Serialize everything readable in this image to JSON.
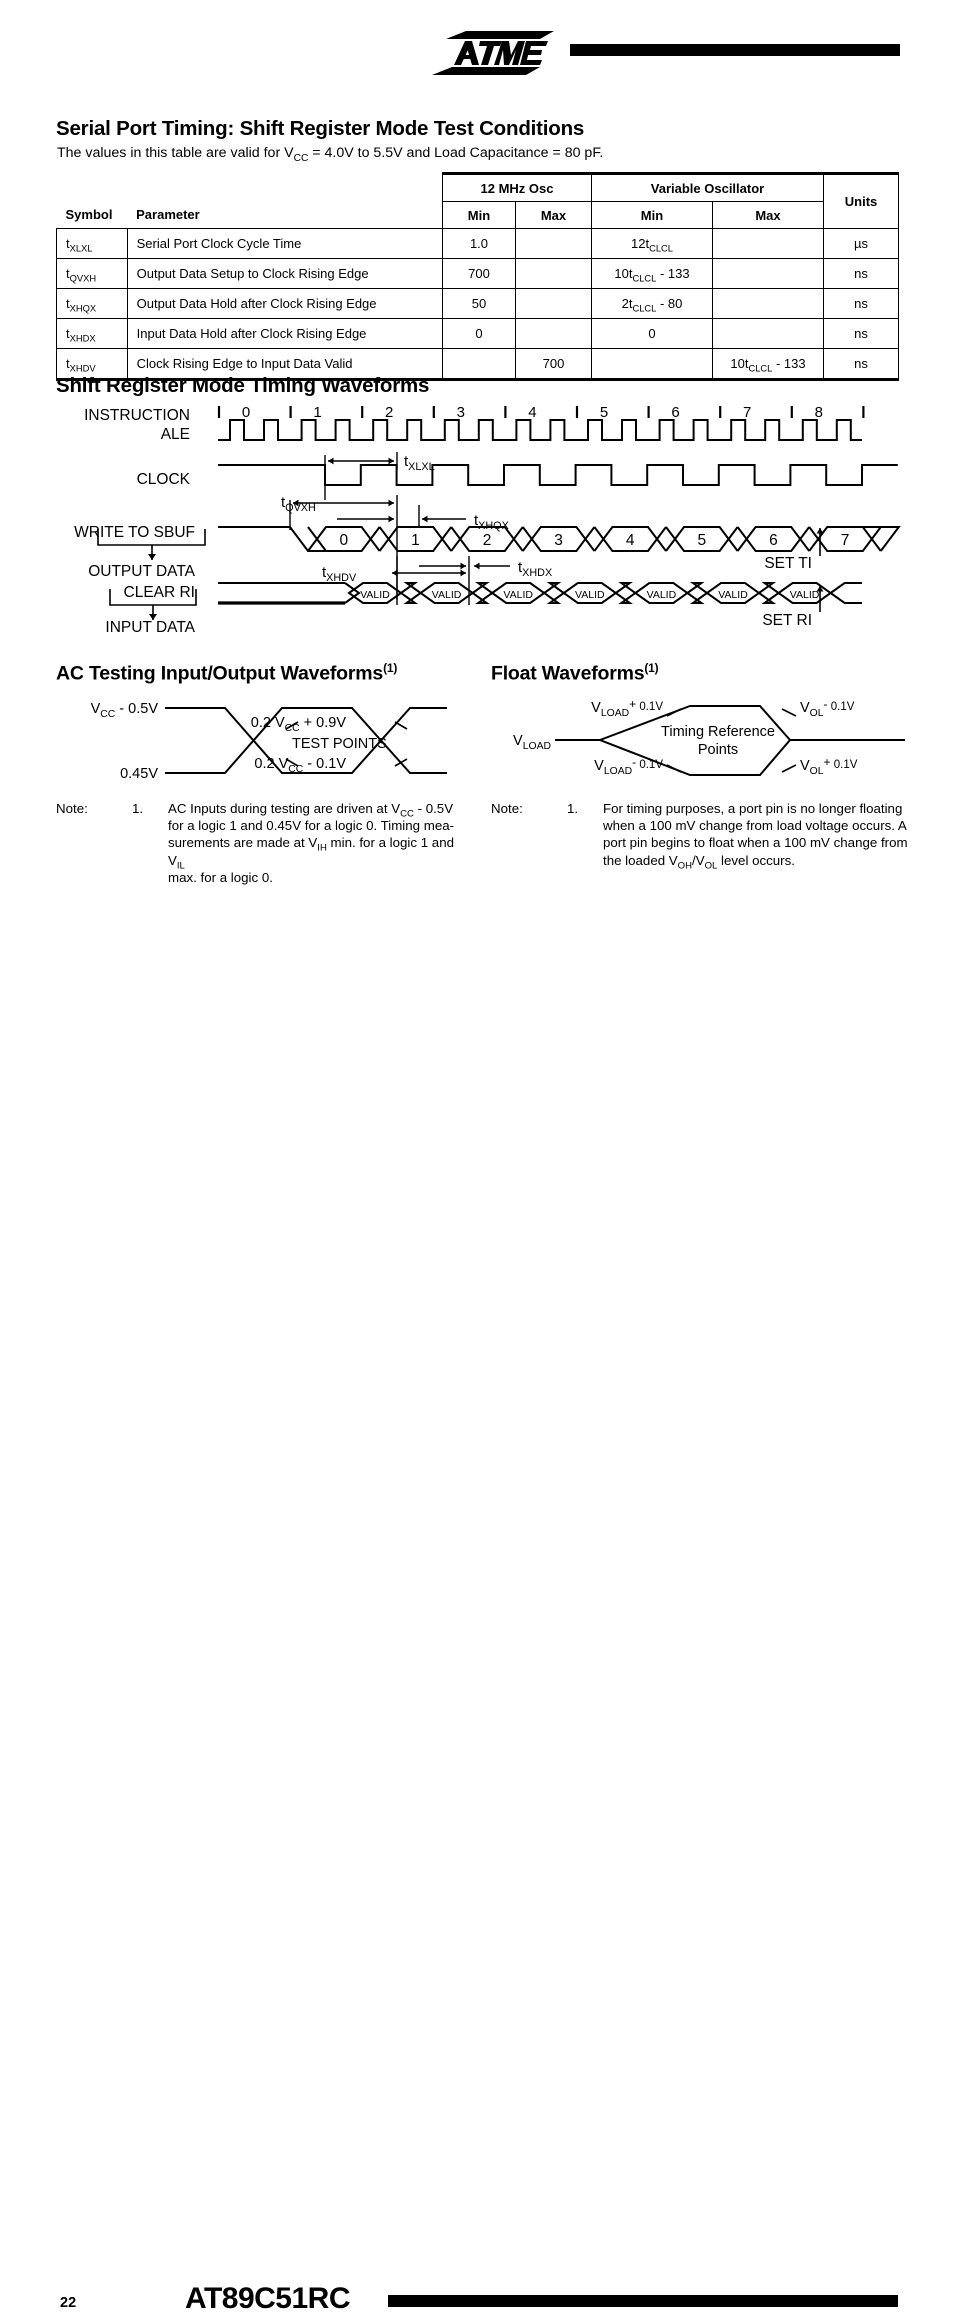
{
  "header": {
    "logo_text": "ATMEL",
    "logo_icon": "atmel-logo"
  },
  "sections": {
    "serial_port_title": "Serial Port Timing: Shift Register Mode Test Conditions",
    "serial_port_intro_a": "The values in this table are valid for V",
    "serial_port_intro_b": "CC",
    "serial_port_intro_c": " = 4.0V to 5.5V and Load Capacitance = 80 pF.",
    "shift_register_title": "Shift Register Mode Timing Waveforms",
    "ac_testing_title": "AC Testing Input/Output Waveforms",
    "ac_testing_sup": "(1)",
    "float_title": "Float Waveforms",
    "float_sup": "(1)"
  },
  "table": {
    "group_headers": {
      "osc12": "12 MHz Osc",
      "variable": "Variable Oscillator"
    },
    "columns": {
      "symbol": "Symbol",
      "parameter": "Parameter",
      "min1": "Min",
      "max1": "Max",
      "min2": "Min",
      "max2": "Max",
      "units": "Units"
    },
    "rows": [
      {
        "symbol_base": "t",
        "symbol_sub": "XLXL",
        "parameter": "Serial Port Clock Cycle Time",
        "min1": "1.0",
        "max1": "",
        "min2_pre": "12t",
        "min2_sub": "CLCL",
        "min2_post": "",
        "max2_pre": "",
        "max2_sub": "",
        "max2_post": "",
        "units": "µs"
      },
      {
        "symbol_base": "t",
        "symbol_sub": "QVXH",
        "parameter": "Output Data Setup to Clock Rising Edge",
        "min1": "700",
        "max1": "",
        "min2_pre": "10t",
        "min2_sub": "CLCL",
        "min2_post": " - 133",
        "max2_pre": "",
        "max2_sub": "",
        "max2_post": "",
        "units": "ns"
      },
      {
        "symbol_base": "t",
        "symbol_sub": "XHQX",
        "parameter": "Output Data Hold after Clock Rising Edge",
        "min1": "50",
        "max1": "",
        "min2_pre": "2t",
        "min2_sub": "CLCL",
        "min2_post": " - 80",
        "max2_pre": "",
        "max2_sub": "",
        "max2_post": "",
        "units": "ns"
      },
      {
        "symbol_base": "t",
        "symbol_sub": "XHDX",
        "parameter": "Input Data Hold after Clock Rising Edge",
        "min1": "0",
        "max1": "",
        "min2_pre": "0",
        "min2_sub": "",
        "min2_post": "",
        "max2_pre": "",
        "max2_sub": "",
        "max2_post": "",
        "units": "ns"
      },
      {
        "symbol_base": "t",
        "symbol_sub": "XHDV",
        "parameter": "Clock Rising Edge to Input Data Valid",
        "min1": "",
        "max1": "700",
        "min2_pre": "",
        "min2_sub": "",
        "min2_post": "",
        "max2_pre": "10t",
        "max2_sub": "CLCL",
        "max2_post": " - 133",
        "units": "ns"
      }
    ]
  },
  "waveform": {
    "row_labels": {
      "instruction": "INSTRUCTION",
      "ale": "ALE",
      "clock": "CLOCK",
      "write_to_sbuf": "WRITE TO SBUF",
      "output_data": "OUTPUT DATA",
      "clear_ri": "CLEAR RI",
      "input_data": "INPUT DATA"
    },
    "instruction_numbers": [
      "0",
      "1",
      "2",
      "3",
      "4",
      "5",
      "6",
      "7",
      "8"
    ],
    "output_data_values": [
      "0",
      "1",
      "2",
      "3",
      "4",
      "5",
      "6",
      "7"
    ],
    "input_data_value": "VALID",
    "input_data_count": 7,
    "timing_marks": {
      "txlxl_base": "t",
      "txlxl_sub": "XLXL",
      "tqvxh_base": "t",
      "tqvxh_sub": "QVXH",
      "txhqx_base": "t",
      "txhqx_sub": "XHQX",
      "txhdx_base": "t",
      "txhdx_sub": "XHDX",
      "txhdv_base": "t",
      "txhdv_sub": "XHDV"
    },
    "set_ti": "SET TI",
    "set_ri": "SET RI"
  },
  "ac_waveform": {
    "top_level_pre": "V",
    "top_level_sub": "CC",
    "top_level_post": " -  0.5V",
    "bottom_level": "0.45V",
    "upper_test_pre": "0.2  V",
    "upper_test_sub": "CC",
    "upper_test_post": "  +  0.9V",
    "lower_test_pre": "0.2  V",
    "lower_test_sub": "CC",
    "lower_test_post": "  -  0.1V",
    "center_label": "TEST  POINTS"
  },
  "float_waveform": {
    "vload_label_pre": "V",
    "vload_label_sub": "LOAD",
    "upper_left_pre": "V",
    "upper_left_sub": "LOAD",
    "upper_left_sup": "+",
    "upper_left_post": " 0.1V",
    "lower_left_pre": "V",
    "lower_left_sub": "LOAD",
    "lower_left_sup": "-",
    "lower_left_post": " 0.1V",
    "upper_right_pre": "V",
    "upper_right_sub": "OL",
    "upper_right_sup": "-",
    "upper_right_post": " 0.1V",
    "lower_right_pre": "V",
    "lower_right_sub": "OL",
    "lower_right_sup": "+",
    "lower_right_post": " 0.1V",
    "center_line1": "Timing  Reference",
    "center_line2": "Points"
  },
  "notes": {
    "label": "Note:",
    "number": "1.",
    "left_lines": [
      {
        "t": "AC Inputs during testing are driven at V",
        "sub": "CC",
        "t2": " - 0.5V"
      },
      {
        "t": "for a logic 1 and 0.45V for a logic 0. Timing mea-",
        "sub": "",
        "t2": ""
      },
      {
        "t": "surements are made at V",
        "sub": "IH",
        "t2": " min. for a logic 1 and V",
        "sub2": "IL"
      },
      {
        "t": "max. for a logic 0.",
        "sub": "",
        "t2": ""
      }
    ],
    "right_lines": [
      {
        "t": "For timing purposes, a port pin is no longer floating",
        "sub": "",
        "t2": ""
      },
      {
        "t": "when a 100 mV change from load voltage occurs. A",
        "sub": "",
        "t2": ""
      },
      {
        "t": "port pin begins to float when a 100 mV change from",
        "sub": "",
        "t2": ""
      },
      {
        "t": "the loaded V",
        "sub": "OH",
        "t2": "/V",
        "sub2": "OL",
        "t3": " level occurs."
      }
    ]
  },
  "footer": {
    "page_number": "22",
    "part_number": "AT89C51RC"
  }
}
